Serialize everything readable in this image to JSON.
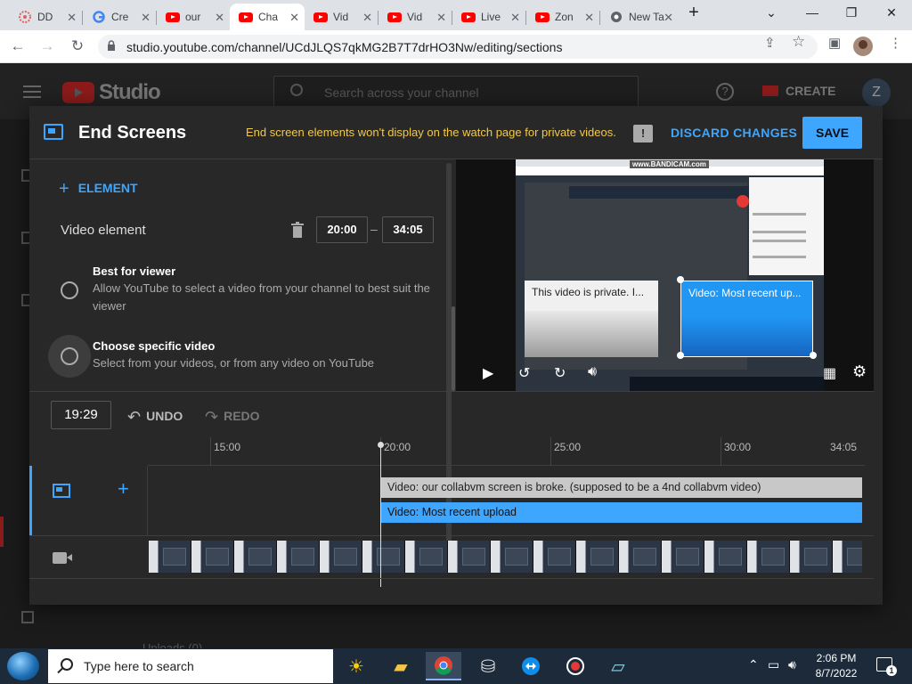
{
  "browser": {
    "tabs": [
      {
        "title": "DD",
        "favicon": "flower-icon"
      },
      {
        "title": "Cre",
        "favicon": "google-icon"
      },
      {
        "title": "our",
        "favicon": "youtube-icon"
      },
      {
        "title": "Cha",
        "favicon": "youtube-icon",
        "active": true
      },
      {
        "title": "Vid",
        "favicon": "youtube-icon"
      },
      {
        "title": "Vid",
        "favicon": "youtube-icon"
      },
      {
        "title": "Live",
        "favicon": "youtube-icon"
      },
      {
        "title": "Zon",
        "favicon": "youtube-icon"
      },
      {
        "title": "New Ta",
        "favicon": "chrome-icon"
      }
    ],
    "url": "studio.youtube.com/channel/UCdJLQS7qkMG2B7T7drHO3Nw/editing/sections"
  },
  "studio": {
    "logo_text": "Studio",
    "search_placeholder": "Search across your channel",
    "create_label": "CREATE",
    "avatar_letter": "Z",
    "uploads_peek": "Uploads (0)"
  },
  "dialog": {
    "title": "End Screens",
    "warning": "End screen elements won't display on the watch page for private videos.",
    "discard_label": "DISCARD CHANGES",
    "save_label": "SAVE",
    "add_element_label": "ELEMENT",
    "element_label": "Video element",
    "start_time": "20:00",
    "end_time": "34:05",
    "options": [
      {
        "title": "Best for viewer",
        "desc": "Allow YouTube to select a video from your channel to best suit the viewer",
        "selected": false
      },
      {
        "title": "Choose specific video",
        "desc": "Select from your videos, or from any video on YouTube",
        "selected": false
      }
    ],
    "preview": {
      "card_private": "This video is private. I...",
      "card_recent": "Video: Most recent up...",
      "watermark": "www.BANDICAM.com"
    },
    "timeline": {
      "current_time": "19:29",
      "undo_label": "UNDO",
      "redo_label": "REDO",
      "ticks": [
        "15:00",
        "20:00",
        "25:00",
        "30:00",
        "34:05"
      ],
      "bar_private": "Video: our collabvm screen is broke. (supposed to be a 4nd collabvm video)",
      "bar_recent": "Video: Most recent upload"
    }
  },
  "taskbar": {
    "search_placeholder": "Type here to search",
    "time": "2:06 PM",
    "date": "8/7/2022",
    "notification_count": "1"
  },
  "colors": {
    "accent": "#3ea6ff",
    "warning": "#f2c94c",
    "youtube_red": "#ff0000",
    "dialog_bg": "#282828"
  }
}
